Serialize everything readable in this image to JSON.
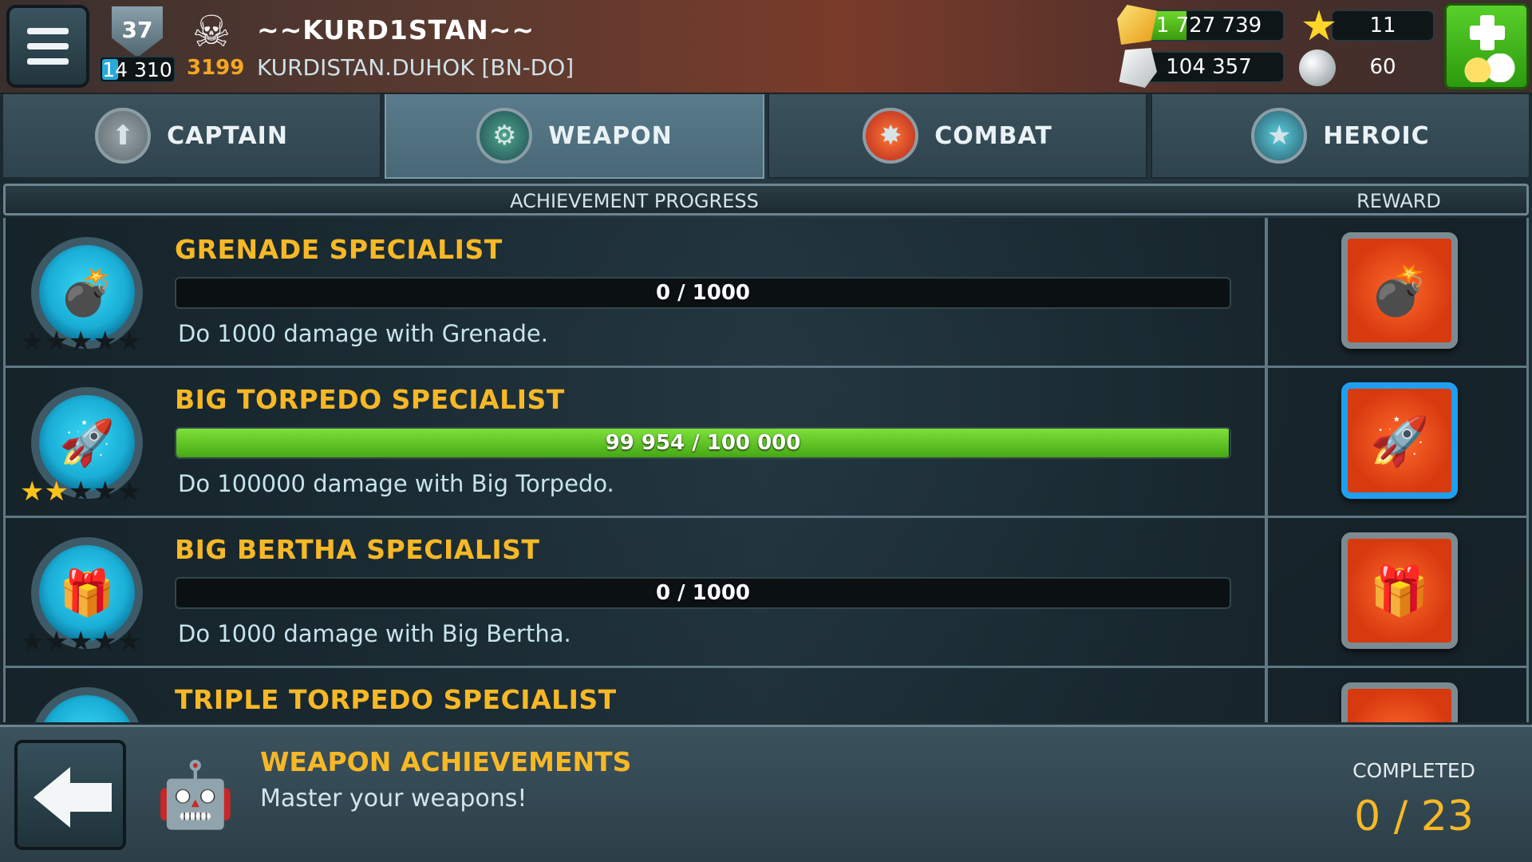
{
  "player": {
    "level": "37",
    "xp": "14 310",
    "trophies": "3199",
    "name": "~~KURD1STAN~~",
    "alliance": "KURDISTAN.DUHOK [BN-DO]"
  },
  "resources": {
    "gold": "1 727 739",
    "gold_fill": 0.35,
    "stone": "104 357",
    "stars": "11",
    "pearls": "60"
  },
  "icons": {
    "menu": "menu-icon",
    "skull": "skull-icon",
    "gold": "gold-icon",
    "stone": "stone-icon",
    "star": "star-icon",
    "pearl": "pearl-icon",
    "plus": "plus-icon",
    "back": "back-arrow-icon"
  },
  "tabs": [
    {
      "label": "CAPTAIN",
      "icon": "captain-icon",
      "active": false
    },
    {
      "label": "WEAPON",
      "icon": "weapon-icon",
      "active": true
    },
    {
      "label": "COMBAT",
      "icon": "combat-icon",
      "active": false
    },
    {
      "label": "HEROIC",
      "icon": "heroic-icon",
      "active": false
    }
  ],
  "list_header": {
    "progress": "ACHIEVEMENT PROGRESS",
    "reward": "REWARD"
  },
  "achievements": [
    {
      "title": "GRENADE SPECIALIST",
      "progress_text": "0 / 1000",
      "progress": 0,
      "description": "Do 1000 damage with Grenade.",
      "stars": 0,
      "icon": "grenade-icon",
      "reward_frame": "gray"
    },
    {
      "title": "BIG TORPEDO SPECIALIST",
      "progress_text": "99 954 / 100 000",
      "progress": 0.99954,
      "description": "Do 100000 damage with Big Torpedo.",
      "stars": 2,
      "icon": "big-torpedo-icon",
      "reward_frame": "blue"
    },
    {
      "title": "BIG BERTHA SPECIALIST",
      "progress_text": "0 / 1000",
      "progress": 0,
      "description": "Do 1000 damage with Big Bertha.",
      "stars": 0,
      "icon": "big-bertha-icon",
      "reward_frame": "gray"
    },
    {
      "title": "TRIPLE TORPEDO SPECIALIST",
      "progress_text": "",
      "progress": 0,
      "description": "",
      "stars": 0,
      "icon": "triple-torpedo-icon",
      "reward_frame": "gray"
    }
  ],
  "footer": {
    "title": "WEAPON ACHIEVEMENTS",
    "subtitle": "Master your weapons!",
    "completed_label": "COMPLETED",
    "completed": "0",
    "separator": "/",
    "total": "23"
  },
  "colors": {
    "accent_gold": "#f7b826",
    "progress_green": "#5cc41f",
    "plus_green": "#3fb61a",
    "icon_cyan": "#1aaed6"
  }
}
